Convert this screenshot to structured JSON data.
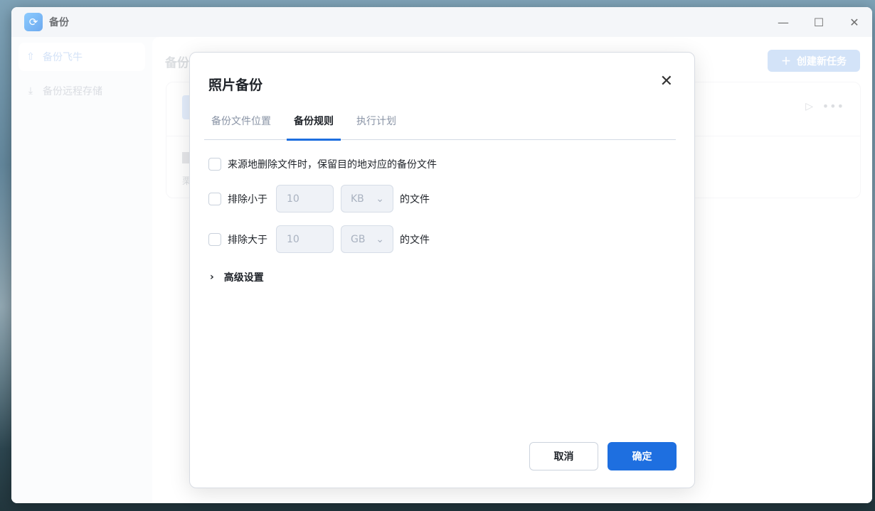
{
  "window": {
    "title": "备份",
    "app_icon": "sync-icon",
    "controls": [
      "minimize",
      "maximize",
      "close"
    ]
  },
  "sidebar": {
    "items": [
      {
        "label": "备份飞牛",
        "icon": "cloud-upload-icon",
        "active": true
      },
      {
        "label": "备份远程存储",
        "icon": "download-icon",
        "active": false
      }
    ]
  },
  "main": {
    "title": "备份",
    "create_button": "创建新任务",
    "card": {
      "subtitle": "栗"
    }
  },
  "dialog": {
    "title": "照片备份",
    "tabs": [
      {
        "label": "备份文件位置",
        "active": false
      },
      {
        "label": "备份规则",
        "active": true
      },
      {
        "label": "执行计划",
        "active": false
      }
    ],
    "rules": {
      "keep_backup": {
        "label": "来源地删除文件时，保留目的地对应的备份文件",
        "checked": false
      },
      "exclude_smaller": {
        "label": "排除小于",
        "value": "10",
        "unit": "KB",
        "suffix": "的文件",
        "checked": false
      },
      "exclude_larger": {
        "label": "排除大于",
        "value": "10",
        "unit": "GB",
        "suffix": "的文件",
        "checked": false
      }
    },
    "advanced": "高级设置",
    "cancel": "取消",
    "confirm": "确定"
  },
  "colors": {
    "accent": "#1e6fe0",
    "accent_disabled": "#bcd5f5"
  }
}
